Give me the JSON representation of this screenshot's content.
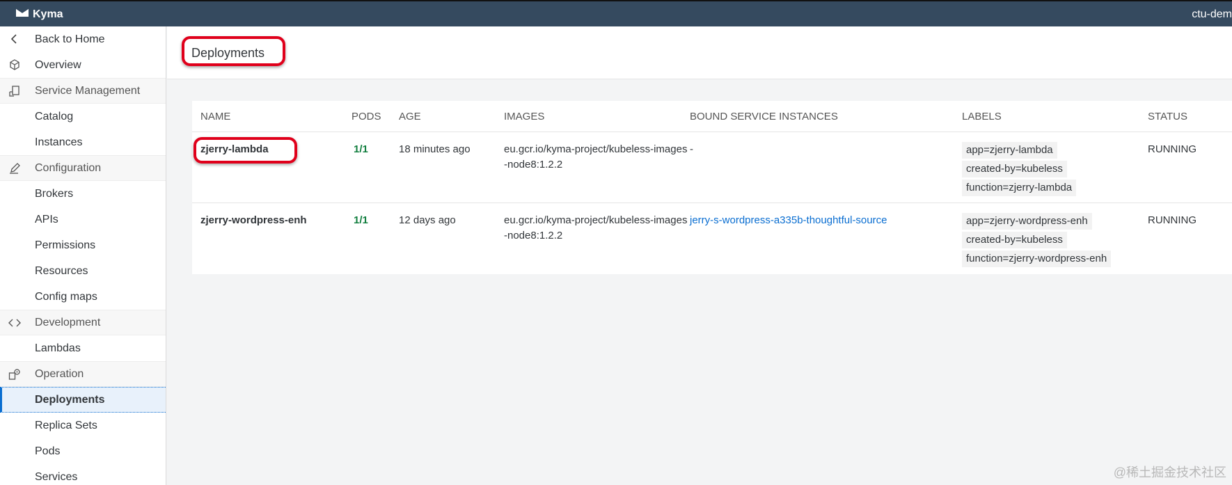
{
  "app": {
    "title": "Kyma",
    "user": "ctu-dem"
  },
  "sidebar": {
    "items": [
      {
        "label": "Back to Home",
        "icon": "chevron-left-icon",
        "kind": "item"
      },
      {
        "label": "Overview",
        "icon": "cube-icon",
        "kind": "item"
      },
      {
        "label": "Service Management",
        "icon": "service-icon",
        "kind": "group"
      },
      {
        "label": "Catalog",
        "kind": "item"
      },
      {
        "label": "Instances",
        "kind": "item"
      },
      {
        "label": "Configuration",
        "icon": "edit-icon",
        "kind": "group"
      },
      {
        "label": "Brokers",
        "kind": "item"
      },
      {
        "label": "APIs",
        "kind": "item"
      },
      {
        "label": "Permissions",
        "kind": "item"
      },
      {
        "label": "Resources",
        "kind": "item"
      },
      {
        "label": "Config maps",
        "kind": "item"
      },
      {
        "label": "Development",
        "icon": "code-icon",
        "kind": "group"
      },
      {
        "label": "Lambdas",
        "kind": "item"
      },
      {
        "label": "Operation",
        "icon": "operation-icon",
        "kind": "group"
      },
      {
        "label": "Deployments",
        "kind": "item",
        "active": true
      },
      {
        "label": "Replica Sets",
        "kind": "item"
      },
      {
        "label": "Pods",
        "kind": "item"
      },
      {
        "label": "Services",
        "kind": "item"
      }
    ]
  },
  "main": {
    "title": "Deployments",
    "table": {
      "columns": [
        "NAME",
        "PODS",
        "AGE",
        "IMAGES",
        "BOUND SERVICE INSTANCES",
        "LABELS",
        "STATUS"
      ],
      "rows": [
        {
          "name": "zjerry-lambda",
          "pods": "1/1",
          "age": "18 minutes ago",
          "images": "eu.gcr.io/kyma-project/kubeless-images-node8:1.2.2",
          "bound": "-",
          "labels": [
            "app=zjerry-lambda",
            "created-by=kubeless",
            "function=zjerry-lambda"
          ],
          "status": "RUNNING"
        },
        {
          "name": "zjerry-wordpress-enh",
          "pods": "1/1",
          "age": "12 days ago",
          "images": "eu.gcr.io/kyma-project/kubeless-images-node8:1.2.2",
          "bound": "jerry-s-wordpress-a335b-thoughtful-source",
          "labels": [
            "app=zjerry-wordpress-enh",
            "created-by=kubeless",
            "function=zjerry-wordpress-enh"
          ],
          "status": "RUNNING"
        }
      ]
    }
  },
  "watermark": "@稀土掘金技术社区",
  "colors": {
    "shell": "#354a5f",
    "highlight": "#e0001b",
    "link": "#0a6ed1",
    "pods_ok": "#107e3e"
  }
}
